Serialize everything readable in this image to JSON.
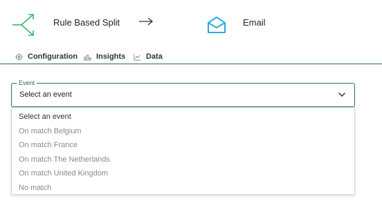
{
  "header": {
    "split_title": "Rule Based Split",
    "email_title": "Email",
    "icons": {
      "split": "split-arrows-icon",
      "arrow": "arrow-right-icon",
      "email": "envelope-open-icon"
    },
    "colors": {
      "split_icon": "#3cb371",
      "email_icon": "#29a8e0",
      "accent": "#2e6b5a"
    }
  },
  "tabs": [
    {
      "label": "Configuration",
      "icon": "gear-icon"
    },
    {
      "label": "Insights",
      "icon": "bar-chart-icon"
    },
    {
      "label": "Data",
      "icon": "data-chart-icon"
    }
  ],
  "event_select": {
    "label": "Event",
    "value": "Select an event",
    "expanded": true,
    "options": [
      "Select an event",
      "On match Belgium",
      "On match France",
      "On match The Netherlands",
      "On match United Kingdom",
      "No match"
    ]
  }
}
